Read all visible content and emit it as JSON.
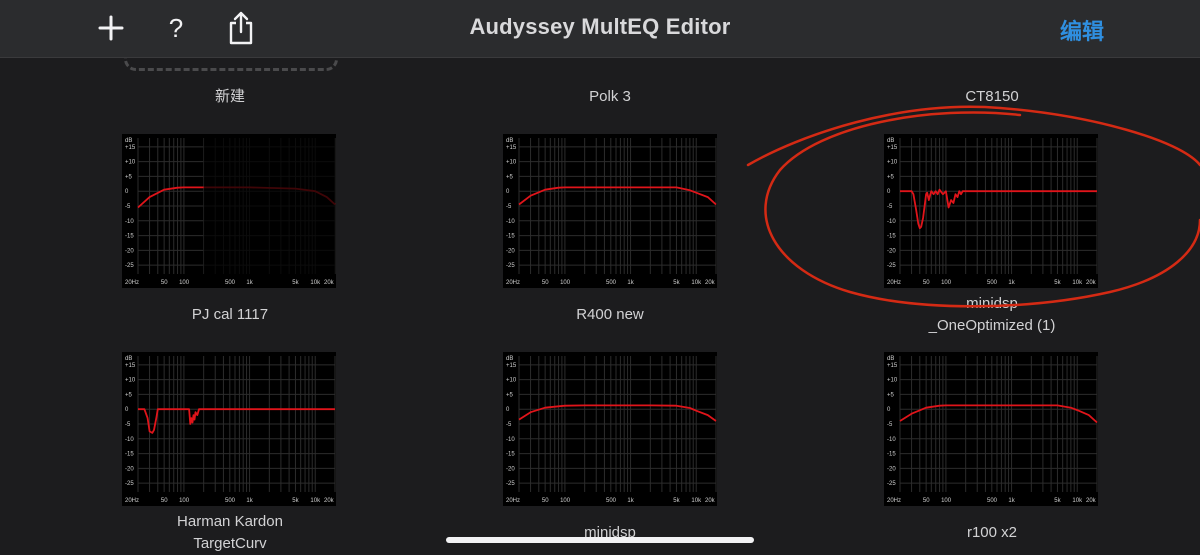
{
  "nav": {
    "title": "Audyssey MultEQ Editor",
    "edit_label": "编辑",
    "accent_color": "#2f8fe0",
    "icons": [
      "plus-icon",
      "help-icon",
      "share-icon"
    ],
    "help_glyph": "?"
  },
  "curve_color": "#e0141a",
  "annotation_color": "#d42a14",
  "axis": {
    "y_ticks": [
      "dB",
      "+15",
      "+10",
      "+5",
      "0",
      "-5",
      "-10",
      "-15",
      "-20",
      "-25"
    ],
    "x_ticks": [
      "20Hz",
      "50",
      "100",
      "500",
      "1k",
      "5k",
      "10k",
      "20k"
    ]
  },
  "tiles": [
    {
      "label": "新建",
      "label2": ""
    },
    {
      "label": "Polk 3",
      "label2": ""
    },
    {
      "label": "CT8150",
      "label2": ""
    },
    {
      "label": "PJ cal 1117",
      "label2": ""
    },
    {
      "label": "R400 new",
      "label2": ""
    },
    {
      "label": "minidsp",
      "label2": "_OneOptimized (1)"
    },
    {
      "label": "Harman Kardon",
      "label2": "TargetCurv"
    },
    {
      "label": "minidsp",
      "label2": ""
    },
    {
      "label": "r100 x2",
      "label2": ""
    }
  ],
  "chart_data": [
    {
      "type": "line",
      "name": "PJ cal 1117",
      "ylim": [
        -28,
        18
      ],
      "xlim": [
        20,
        20000
      ],
      "x_scale": "log",
      "series": [
        {
          "x": [
            20,
            30,
            50,
            80,
            100,
            200,
            500,
            1000,
            5000,
            10000,
            15000,
            20000
          ],
          "y": [
            -5.5,
            -2,
            0.5,
            1.2,
            1.3,
            1.3,
            1.3,
            1.3,
            0.9,
            0,
            -2,
            -4.5
          ]
        }
      ],
      "dimmed_from_hz": 200
    },
    {
      "type": "line",
      "name": "R400 new",
      "ylim": [
        -28,
        18
      ],
      "xlim": [
        20,
        20000
      ],
      "x_scale": "log",
      "series": [
        {
          "x": [
            20,
            30,
            50,
            80,
            100,
            200,
            500,
            1000,
            2000,
            5000,
            8000,
            10000,
            15000,
            20000
          ],
          "y": [
            -4.5,
            -1.5,
            0.5,
            1.2,
            1.3,
            1.3,
            1.3,
            1.3,
            1.3,
            1.3,
            0.3,
            -0.5,
            -2,
            -4.5
          ]
        }
      ]
    },
    {
      "type": "line",
      "name": "minidsp _OneOptimized (1)",
      "ylim": [
        -28,
        18
      ],
      "xlim": [
        20,
        20000
      ],
      "x_scale": "log",
      "series": [
        {
          "x": [
            20,
            30,
            32,
            35,
            38,
            40,
            42,
            45,
            48,
            50,
            52,
            55,
            58,
            60,
            65,
            70,
            75,
            80,
            90,
            100,
            110,
            120,
            130,
            140,
            150,
            160,
            170,
            180,
            200,
            250,
            300,
            1000,
            20000
          ],
          "y": [
            0,
            0,
            -1,
            -6,
            -11,
            -12.5,
            -12,
            -9,
            -4,
            -1,
            -0.5,
            -3,
            -1,
            0,
            -1,
            0,
            -1,
            0.5,
            -1,
            0,
            -5.5,
            -3,
            -4,
            -1,
            -2,
            0,
            -1,
            0,
            0,
            0,
            0,
            0,
            0
          ]
        }
      ]
    },
    {
      "type": "line",
      "name": "Harman Kardon TargetCurv",
      "ylim": [
        -28,
        18
      ],
      "xlim": [
        20,
        20000
      ],
      "x_scale": "log",
      "series": [
        {
          "x": [
            20,
            25,
            28,
            30,
            33,
            35,
            38,
            40,
            50,
            100,
            120,
            125,
            130,
            135,
            140,
            145,
            150,
            160,
            170,
            180,
            200,
            1000,
            20000
          ],
          "y": [
            0,
            0,
            -3,
            -7.5,
            -8,
            -7,
            -3,
            0,
            0,
            0,
            0,
            -5,
            -3,
            -4.5,
            -2,
            -3.5,
            -1,
            -2,
            0,
            0,
            0,
            0,
            0
          ]
        }
      ]
    },
    {
      "type": "line",
      "name": "minidsp",
      "ylim": [
        -28,
        18
      ],
      "xlim": [
        20,
        20000
      ],
      "x_scale": "log",
      "series": [
        {
          "x": [
            20,
            30,
            50,
            80,
            100,
            200,
            500,
            1000,
            2000,
            5000,
            8000,
            10000,
            15000,
            20000
          ],
          "y": [
            -3.5,
            -1,
            0.5,
            1,
            1.2,
            1.3,
            1.3,
            1.3,
            1.3,
            1.2,
            0.4,
            -0.5,
            -2,
            -4
          ]
        }
      ]
    },
    {
      "type": "line",
      "name": "r100 x2",
      "ylim": [
        -28,
        18
      ],
      "xlim": [
        20,
        20000
      ],
      "x_scale": "log",
      "series": [
        {
          "x": [
            20,
            30,
            50,
            80,
            100,
            200,
            500,
            1000,
            2000,
            5000,
            8000,
            10000,
            15000,
            20000
          ],
          "y": [
            -4,
            -1.5,
            0.5,
            1.2,
            1.3,
            1.3,
            1.3,
            1.3,
            1.3,
            1.3,
            0.5,
            -0.3,
            -2,
            -4.5
          ]
        }
      ]
    }
  ]
}
